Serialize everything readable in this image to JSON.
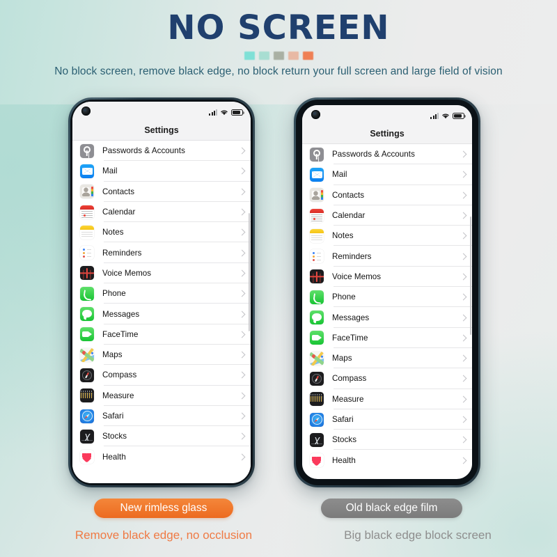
{
  "header": {
    "title": "NO SCREEN",
    "subtitle": "No block screen, remove black edge, no block return your full screen and large field of vision",
    "title_color": "#20406e",
    "subtitle_color": "#2b5f72",
    "swatches": [
      "#7fe0d6",
      "#a8ded2",
      "#a9b0a3",
      "#e8b9a4",
      "#ef8055"
    ]
  },
  "phones": [
    {
      "variant": "rimless",
      "statusbar": {
        "signal_icon": "signal-bars-icon",
        "wifi_icon": "wifi-icon",
        "battery_icon": "battery-icon",
        "camera_icon": "punch-hole-camera-icon"
      },
      "screen_title": "Settings",
      "items": [
        {
          "label": "Passwords & Accounts",
          "icon": "passwords-icon"
        },
        {
          "label": "Mail",
          "icon": "mail-icon"
        },
        {
          "label": "Contacts",
          "icon": "contacts-icon"
        },
        {
          "label": "Calendar",
          "icon": "calendar-icon"
        },
        {
          "label": "Notes",
          "icon": "notes-icon"
        },
        {
          "label": "Reminders",
          "icon": "reminders-icon"
        },
        {
          "label": "Voice Memos",
          "icon": "voice-memos-icon"
        },
        {
          "label": "Phone",
          "icon": "phone-icon"
        },
        {
          "label": "Messages",
          "icon": "messages-icon"
        },
        {
          "label": "FaceTime",
          "icon": "facetime-icon"
        },
        {
          "label": "Maps",
          "icon": "maps-icon"
        },
        {
          "label": "Compass",
          "icon": "compass-icon"
        },
        {
          "label": "Measure",
          "icon": "measure-icon"
        },
        {
          "label": "Safari",
          "icon": "safari-icon"
        },
        {
          "label": "Stocks",
          "icon": "stocks-icon"
        },
        {
          "label": "Health",
          "icon": "health-icon"
        }
      ]
    },
    {
      "variant": "black-edge",
      "statusbar": {
        "signal_icon": "signal-bars-icon",
        "wifi_icon": "wifi-icon",
        "battery_icon": "battery-icon",
        "camera_icon": "punch-hole-camera-icon"
      },
      "screen_title": "Settings",
      "items": [
        {
          "label": "Passwords & Accounts",
          "icon": "passwords-icon"
        },
        {
          "label": "Mail",
          "icon": "mail-icon"
        },
        {
          "label": "Contacts",
          "icon": "contacts-icon"
        },
        {
          "label": "Calendar",
          "icon": "calendar-icon"
        },
        {
          "label": "Notes",
          "icon": "notes-icon"
        },
        {
          "label": "Reminders",
          "icon": "reminders-icon"
        },
        {
          "label": "Voice Memos",
          "icon": "voice-memos-icon"
        },
        {
          "label": "Phone",
          "icon": "phone-icon"
        },
        {
          "label": "Messages",
          "icon": "messages-icon"
        },
        {
          "label": "FaceTime",
          "icon": "facetime-icon"
        },
        {
          "label": "Maps",
          "icon": "maps-icon"
        },
        {
          "label": "Compass",
          "icon": "compass-icon"
        },
        {
          "label": "Measure",
          "icon": "measure-icon"
        },
        {
          "label": "Safari",
          "icon": "safari-icon"
        },
        {
          "label": "Stocks",
          "icon": "stocks-icon"
        },
        {
          "label": "Health",
          "icon": "health-icon"
        }
      ]
    }
  ],
  "footer": {
    "left_badge": "New rimless glass",
    "left_caption": "Remove black edge, no occlusion",
    "right_badge": "Old black edge film",
    "right_caption": "Big black edge block screen",
    "left_badge_color": "#ec6a20",
    "right_badge_color": "#7b7b7b",
    "left_caption_color": "#ef7a44",
    "right_caption_color": "#8e8e8e"
  }
}
